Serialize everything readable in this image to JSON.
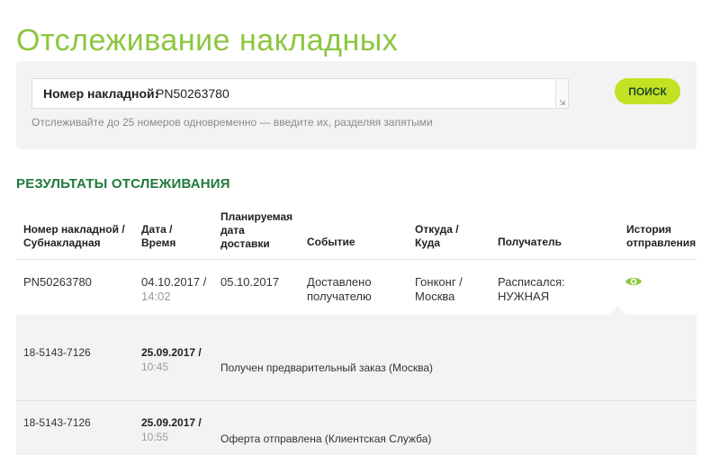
{
  "page_title": "Отслеживание накладных",
  "search": {
    "label": "Номер накладной:",
    "value": "PN50263780",
    "button_label": "ПОИСК",
    "hint": "Отслеживайте до 25 номеров одновременно — введите их, разделяя запятыми"
  },
  "results": {
    "heading": "РЕЗУЛЬТАТЫ ОТСЛЕЖИВАНИЯ",
    "columns": {
      "number": [
        "Номер накладной /",
        "Субнакладная"
      ],
      "datetime": [
        "Дата /",
        "Время"
      ],
      "planned": [
        "Планируемая",
        "дата",
        "доставки"
      ],
      "event": [
        "Событие"
      ],
      "route": [
        "Откуда /",
        "Куда"
      ],
      "recipient": [
        "Получатель"
      ],
      "history": [
        "История",
        "отправления"
      ]
    },
    "main_row": {
      "number": "PN50263780",
      "date": "04.10.2017 /",
      "time": "14:02",
      "planned": "05.10.2017",
      "event": [
        "Доставлено",
        "получателю"
      ],
      "route": [
        "Гонконг /",
        "Москва"
      ],
      "recipient": [
        "Расписался:",
        "НУЖНАЯ"
      ],
      "history_icon": "eye-icon",
      "accent_color": "#8cc63f"
    },
    "sub_rows": [
      {
        "number": "18-5143-7126",
        "date": "25.09.2017 /",
        "time": "10:45",
        "event": "Получен предварительный заказ (Москва)"
      },
      {
        "number": "18-5143-7126",
        "date": "25.09.2017 /",
        "time": "10:55",
        "event": "Оферта отправлена (Клиентская Служба)"
      }
    ]
  },
  "colors": {
    "title": "#8cc63f",
    "heading": "#1f7a3a",
    "button": "#c5e123",
    "panel": "#f3f3f3"
  }
}
